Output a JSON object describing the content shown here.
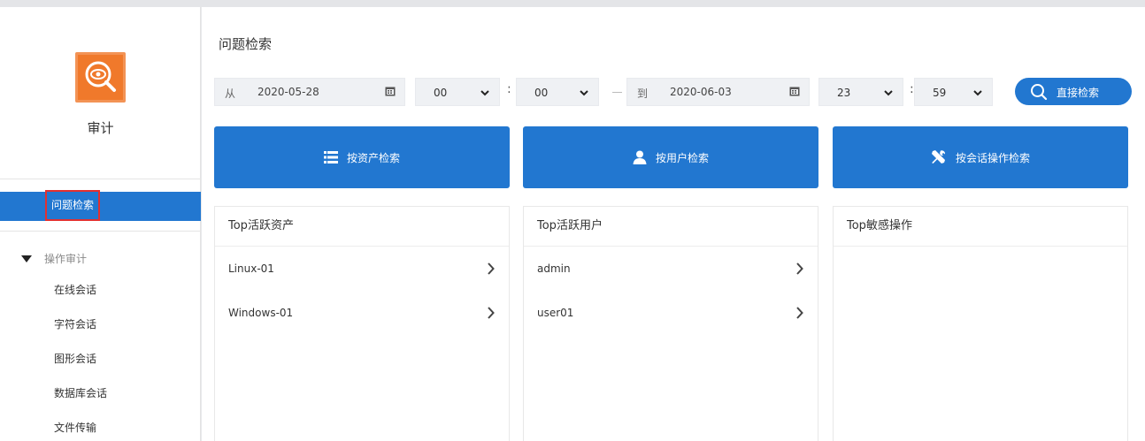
{
  "sidebar": {
    "app_title": "审计",
    "active_item": "问题检索",
    "group_label": "操作审计",
    "items": [
      "在线会话",
      "字符会话",
      "图形会话",
      "数据库会话",
      "文件传输"
    ]
  },
  "main": {
    "title": "问题检索",
    "filters": {
      "from_label": "从",
      "from_date": "2020-05-28",
      "from_hour": "00",
      "from_minute": "00",
      "to_label": "到",
      "to_date": "2020-06-03",
      "to_hour": "23",
      "to_minute": "59",
      "colon": ":",
      "search_label": "直接检索"
    },
    "quick_buttons": [
      {
        "label": "按资产检索",
        "icon": "server-list-icon"
      },
      {
        "label": "按用户检索",
        "icon": "user-icon"
      },
      {
        "label": "按会话操作检索",
        "icon": "tools-icon"
      }
    ],
    "cards": [
      {
        "title": "Top活跃资产",
        "rows": [
          "Linux-01",
          "Windows-01"
        ]
      },
      {
        "title": "Top活跃用户",
        "rows": [
          "admin",
          "user01"
        ]
      },
      {
        "title": "Top敏感操作",
        "rows": []
      }
    ]
  },
  "colors": {
    "accent": "#2277d0",
    "logo": "#f0792b",
    "highlight_border": "#e23030"
  }
}
